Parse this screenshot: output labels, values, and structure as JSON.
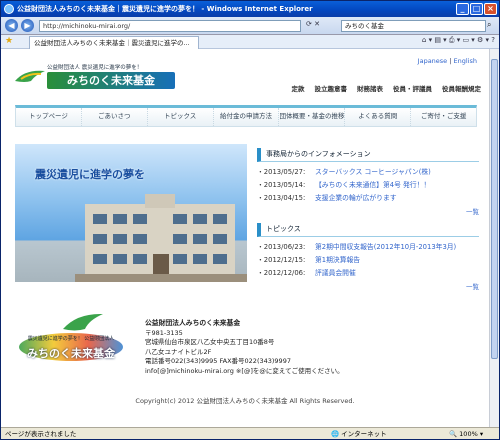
{
  "window": {
    "title": "公益財団法人みちのく未来基金｜震災遺児に進学の夢を！ - Windows Internet Explorer"
  },
  "browser": {
    "address": "http://michinoku-mirai.org/",
    "search_value": "みちのく基金",
    "tab_label": "公益財団法人みちのく未来基金｜震災遺児に進学の...",
    "status_left": "ページが表示されました",
    "status_zone": "インターネット",
    "zoom": "100%"
  },
  "site": {
    "logo_sub": "公益財団法人 震災遺児に進学の夢を！",
    "logo_main": "みちのく未来基金",
    "lang_ja": "Japanese",
    "lang_sep": " | ",
    "lang_en": "English",
    "toplinks": [
      "定款",
      "設立趣意書",
      "財務諸表",
      "役員・評議員",
      "役員報酬規定"
    ]
  },
  "gnav": [
    "トップページ",
    "ごあいさつ",
    "トピックス",
    "給付金の申請方法",
    "団体概要・基金の推移",
    "よくある質問",
    "ご寄付・ご支援"
  ],
  "hero": {
    "text": "震災遺児に進学の夢を"
  },
  "info": {
    "heading": "事務局からのインフォメーション",
    "items": [
      {
        "date": "・2013/05/27:",
        "text": "スターバックス コーヒージャパン(株)"
      },
      {
        "date": "・2013/05/14:",
        "text": "【みちのく未来通信】第4号 発行！！"
      },
      {
        "date": "・2013/04/15:",
        "text": "支援企業の輪が広がります"
      }
    ],
    "more": "一覧"
  },
  "topics": {
    "heading": "トピックス",
    "items": [
      {
        "date": "・2013/06/23:",
        "text": "第2期中間収支報告(2012年10月-2013年3月)"
      },
      {
        "date": "・2012/12/15:",
        "text": "第1期決算報告"
      },
      {
        "date": "・2012/12/06:",
        "text": "評議員会開催"
      }
    ],
    "more": "一覧"
  },
  "footer": {
    "logo_sub": "震災遺児に進学の夢を！ 公益財団法人",
    "logo_main": "みちのく未来基金",
    "org": "公益財団法人みちのく未来基金",
    "zip": "〒981-3135",
    "addr1": "宮城県仙台市泉区八乙女中央五丁目10番8号",
    "addr2": "八乙女ユナイトビル2F",
    "tel": "電話番号022(343)9995 FAX番号022(343)9997",
    "mail": "info[@]michinoku-mirai.org ※[@]を@に変えてご使用ください。",
    "copyright": "Copyright(c) 2012 公益財団法人みちのく未来基金 All Rights Reserved."
  }
}
